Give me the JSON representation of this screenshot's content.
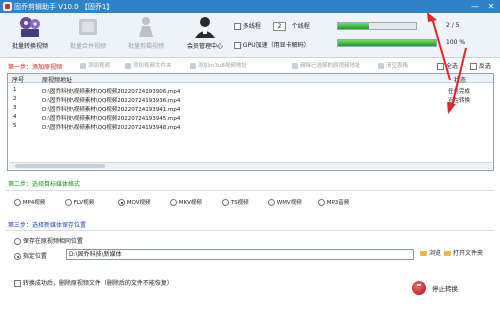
{
  "title_bar": {
    "title": "固乔剪辑助手 V10.0 【固乔1】",
    "minimize_label": "—",
    "close_label": "✕"
  },
  "toolbar": {
    "items": [
      {
        "label": "批量转换视频",
        "icon": "film-convert-icon",
        "enabled": true
      },
      {
        "label": "批量合并视频",
        "icon": "merge-video-icon",
        "enabled": false
      },
      {
        "label": "批量剪辑视频",
        "icon": "cut-video-icon",
        "enabled": false
      },
      {
        "label": "会员管理中心",
        "icon": "member-center-icon",
        "enabled": true
      }
    ]
  },
  "options": {
    "multithread_label": "多线程",
    "thread_count": "2",
    "thread_unit": "个线程",
    "gpu_label": "GPU加速（用显卡解码）"
  },
  "progress": {
    "task_text": "2 / 5",
    "task_fraction": 0.4,
    "current_text": "100 %",
    "current_fraction": 1.0
  },
  "step1": {
    "title": "第一步：添加原视频",
    "tools": [
      {
        "label": "添加视频",
        "icon": "add-video-icon"
      },
      {
        "label": "添加视频文件夹",
        "icon": "add-folder-icon"
      },
      {
        "label": "添加m3u8视频地址",
        "icon": "add-link-icon"
      },
      {
        "label": "删除已选择的原视频地址",
        "icon": "delete-icon"
      },
      {
        "label": "清空表格",
        "icon": "clear-icon"
      }
    ],
    "select_all": "全选",
    "invert": "反选"
  },
  "file_table": {
    "headers": {
      "index": "序号",
      "path": "原视频地址",
      "status": "状态"
    },
    "rows": [
      {
        "index": "1",
        "path": "D:\\固乔科技\\视频素材\\QQ视频20220724193906.mp4",
        "status": "任务完成"
      },
      {
        "index": "2",
        "path": "D:\\固乔科技\\视频素材\\QQ视频20220724193936.mp4",
        "status": "正在转换"
      },
      {
        "index": "3",
        "path": "D:\\固乔科技\\视频素材\\QQ视频20220724193941.mp4",
        "status": ""
      },
      {
        "index": "4",
        "path": "D:\\固乔科技\\视频素材\\QQ视频20220724193945.mp4",
        "status": ""
      },
      {
        "index": "5",
        "path": "D:\\固乔科技\\视频素材\\QQ视频20220724193948.mp4",
        "status": ""
      }
    ]
  },
  "step2": {
    "title": "第二步：选择目标媒体格式",
    "formats": [
      "MP4视频",
      "FLV视频",
      "MOV视频",
      "MKV视频",
      "TS视频",
      "WMV视频",
      "MP3音频"
    ],
    "selected_index": 2
  },
  "step3": {
    "title": "第三步：选择新媒体保存位置",
    "same_location_label": "保存在原视频相同位置",
    "custom_location_label": "指定位置",
    "path_value": "D:\\固乔科技\\新媒体",
    "browse_label": "浏览",
    "open_folder_label": "打开文件夹"
  },
  "footer": {
    "delete_after_label": "转换成功后，删除原视频文件（删除后的文件不能恢复）",
    "stop_label": "停止转换"
  },
  "colors": {
    "titlebar": "#2f84c9",
    "step_red": "#d21f1f",
    "step_green": "#1f8f24",
    "step_blue": "#2445b5",
    "progress_fill": "#2fb52f",
    "annotation_arrow": "#e5232b"
  }
}
